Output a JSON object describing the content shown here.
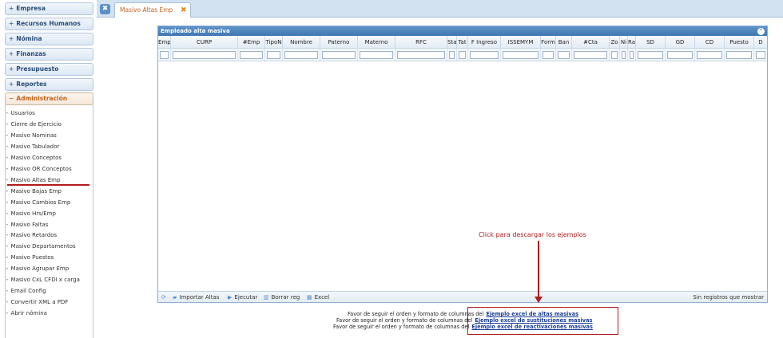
{
  "sidebar": {
    "sections": [
      {
        "label": "Empresa",
        "sign": "+"
      },
      {
        "label": "Recursos Humanos",
        "sign": "+"
      },
      {
        "label": "Nómina",
        "sign": "+"
      },
      {
        "label": "Finanzas",
        "sign": "+"
      },
      {
        "label": "Presupuesto",
        "sign": "+"
      },
      {
        "label": "Reportes",
        "sign": "+"
      },
      {
        "label": "Administración",
        "sign": "−"
      }
    ],
    "admin_items": [
      "Usuarios",
      "Cierre de Ejercicio",
      "Masivo Nominas",
      "Masivo Tabulador",
      "Masivo Conceptos",
      "Masivo OR Conceptos",
      "Masivo Altas Emp",
      "Masivo Bajas Emp",
      "Masivo Cambios Emp",
      "Masivo Hrs/Emp",
      "Masivo Faltas",
      "Masivo Retardos",
      "Masivo Departamentos",
      "Masivo Puestos",
      "Masivo Agrupar Emp",
      "Masivo CxL CFDI x carga",
      "Email Config",
      "Convertir XML a PDF",
      "Abrir nómina"
    ]
  },
  "tabs": {
    "close_all_icon": "✖",
    "active_label": "Masivo Altas Emp",
    "close_icon": "✖"
  },
  "grid": {
    "caption": "Empleado alta masiva",
    "collapse_icon": "chevron-up",
    "columns": [
      "Emp",
      "CURP",
      "#Emp",
      "TipoN",
      "Nombre",
      "Paterno",
      "Materno",
      "RFC",
      "Sta",
      "Tat",
      "F Ingreso",
      "ISSEMYM",
      "Form",
      "Ban",
      "#Cta",
      "Zo",
      "Ni",
      "Ra",
      "SD",
      "GD",
      "CD",
      "Puesto",
      "D"
    ],
    "toolbar": {
      "refresh_icon": "refresh",
      "import_label": "Importar Altas",
      "execute_label": "Ejecutar",
      "delete_label": "Borrar reg",
      "excel_label": "Excel"
    },
    "records_info": "Sin registros que mostrar"
  },
  "annotation": {
    "text": "Click para descargar los ejemplos"
  },
  "notes": [
    {
      "text": "Favor de seguir el orden y formato de columnas del",
      "link": "Ejemplo excel de altas masivas"
    },
    {
      "text": "Favor de seguir el orden y formato de columnas del",
      "link": "Ejemplo excel de sustituciones masivas"
    },
    {
      "text": "Favor de seguir el orden y formato de columnas del",
      "link": "Ejemplo excel de reactivaciones masivas"
    }
  ]
}
